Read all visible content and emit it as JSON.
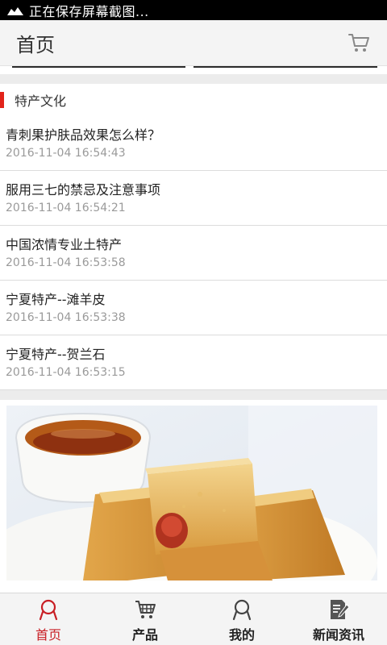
{
  "status_bar": {
    "text": "正在保存屏幕截图..."
  },
  "header": {
    "title": "首页",
    "cart_icon": "cart-icon"
  },
  "section": {
    "title": "特产文化",
    "accent_color": "#e2231a",
    "articles": [
      {
        "title": "青刺果护肤品效果怎么样？",
        "date": "2016-11-04 16:54:43"
      },
      {
        "title": "服用三七的禁忌及注意事项",
        "date": "2016-11-04 16:54:21"
      },
      {
        "title": "中国浓情专业土特产",
        "date": "2016-11-04 16:53:58"
      },
      {
        "title": "宁夏特产--滩羊皮",
        "date": "2016-11-04 16:53:38"
      },
      {
        "title": "宁夏特产--贺兰石",
        "date": "2016-11-04 16:53:15"
      }
    ]
  },
  "bottom_nav": {
    "active_color": "#c81e24",
    "items": [
      {
        "label": "首页",
        "icon": "home-icon",
        "active": true
      },
      {
        "label": "产品",
        "icon": "cart-icon",
        "active": false
      },
      {
        "label": "我的",
        "icon": "user-icon",
        "active": false
      },
      {
        "label": "新闻资讯",
        "icon": "news-edit-icon",
        "active": false
      }
    ]
  }
}
